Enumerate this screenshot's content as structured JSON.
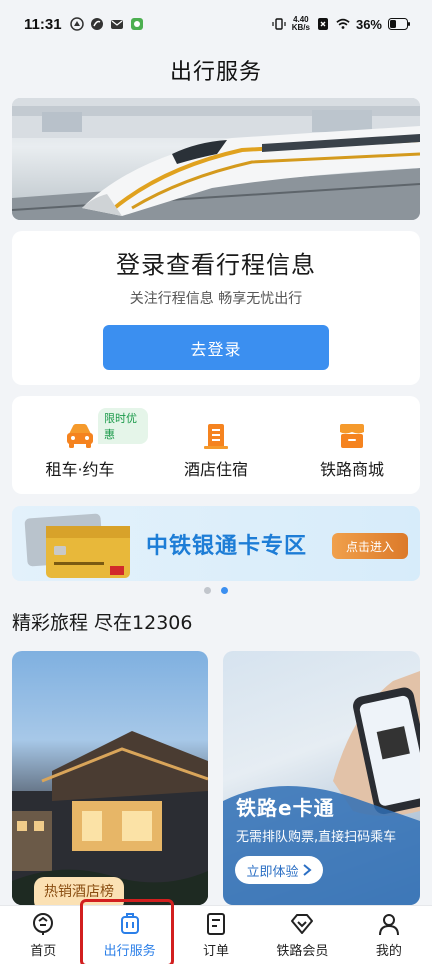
{
  "status_bar": {
    "time": "11:31",
    "net_speed_value": "4.40",
    "net_speed_unit": "KB/s",
    "battery": "36%"
  },
  "header": {
    "title": "出行服务"
  },
  "login_card": {
    "title": "登录查看行程信息",
    "subtitle": "关注行程信息  畅享无忧出行",
    "button_label": "去登录"
  },
  "services": [
    {
      "label": "租车·约车",
      "icon": "car-icon",
      "badge": "限时优惠"
    },
    {
      "label": "酒店住宿",
      "icon": "hotel-icon"
    },
    {
      "label": "铁路商城",
      "icon": "mall-icon"
    }
  ],
  "ad_banner": {
    "title": "中铁银通卡专区",
    "button_label": "点击进入"
  },
  "carousel": {
    "pages": 2,
    "active": 2
  },
  "section": {
    "title": "精彩旅程 尽在12306"
  },
  "features": {
    "hotel": {
      "tag": "热销酒店榜"
    },
    "ecard": {
      "title": "铁路e卡通",
      "subtitle": "无需排队购票,直接扫码乘车",
      "button_label": "立即体验"
    }
  },
  "tabbar": [
    {
      "label": "首页",
      "icon": "home-icon"
    },
    {
      "label": "出行服务",
      "icon": "travel-service-icon",
      "active": true
    },
    {
      "label": "订单",
      "icon": "order-icon"
    },
    {
      "label": "铁路会员",
      "icon": "member-icon"
    },
    {
      "label": "我的",
      "icon": "profile-icon"
    }
  ],
  "colors": {
    "accent": "#3b8ff0",
    "promo_green": "#1b9a4a",
    "highlight_red": "#d21f1f"
  }
}
